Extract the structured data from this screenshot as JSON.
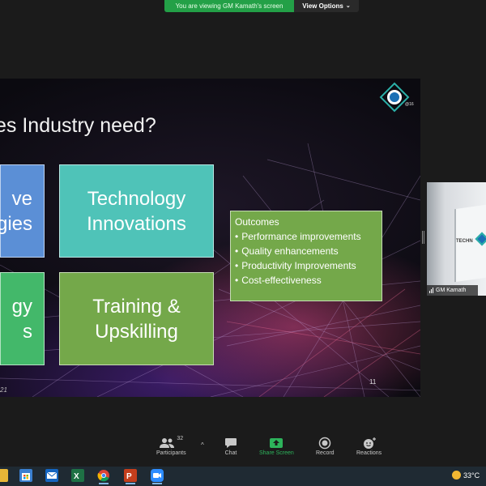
{
  "banner": {
    "viewing_text": "You are viewing GM Kamath's screen",
    "options_label": "View Options",
    "options_icon": "chevron-down-icon"
  },
  "slide": {
    "title": "es Industry need?",
    "logo_text": "@16",
    "boxes": {
      "left_top": "ve\ngies",
      "technology": "Technology\nInnovations",
      "left_bottom": "gy\ns",
      "training": "Training &\nUpskilling"
    },
    "outcomes": {
      "heading": "Outcomes",
      "items": [
        "Performance improvements",
        "Quality enhancements",
        "Productivity Improvements",
        "Cost-effectiveness"
      ]
    },
    "page_number": "11",
    "footer_fragment": "21"
  },
  "video": {
    "name": "GM Kamath",
    "poster_text": "TECHN"
  },
  "controls": {
    "participants_label": "Participants",
    "participants_count": "32",
    "chat_label": "Chat",
    "share_label": "Share Screen",
    "record_label": "Record",
    "reactions_label": "Reactions"
  },
  "taskbar": {
    "temperature": "33°C"
  },
  "colors": {
    "share_green": "#2db35b",
    "banner_green": "#23a047",
    "teal_box": "#4fc3b8",
    "green_box": "#74a84a",
    "blue_box": "#5b8fd6"
  }
}
